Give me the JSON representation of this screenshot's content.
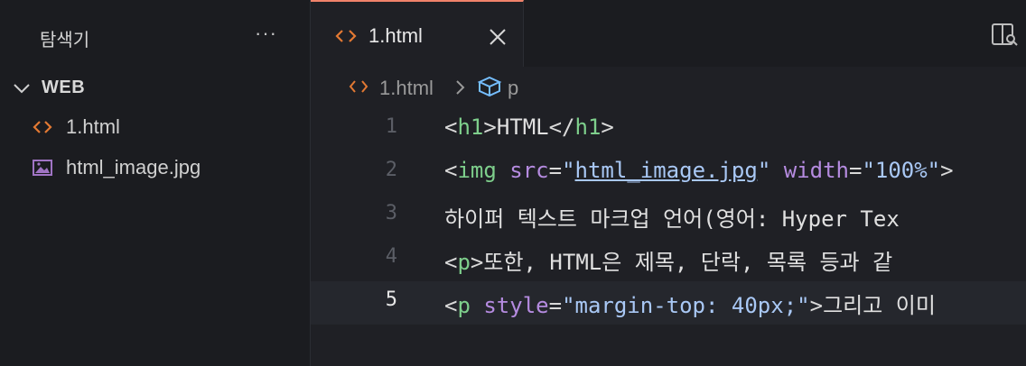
{
  "sidebar": {
    "title": "탐색기",
    "more": "···",
    "folder": "WEB",
    "files": [
      {
        "name": "1.html",
        "icon": "html-file-icon"
      },
      {
        "name": "html_image.jpg",
        "icon": "image-file-icon"
      }
    ]
  },
  "tab": {
    "label": "1.html"
  },
  "breadcrumb": {
    "file": "1.html",
    "element": "p"
  },
  "editor": {
    "current_line": 5,
    "lines": [
      {
        "n": "1"
      },
      {
        "n": "2"
      },
      {
        "n": "3"
      },
      {
        "n": "4"
      },
      {
        "n": "5"
      }
    ],
    "tokens": {
      "l1": {
        "open": "<",
        "tag": "h1",
        "close": ">",
        "text": "HTML",
        "open2": "</",
        "tag2": "h1",
        "close2": ">"
      },
      "l2": {
        "open": "<",
        "tag": "img",
        "sp1": " ",
        "attr1": "src",
        "eq1": "=",
        "val1q1": "\"",
        "val1": "html_image.jpg",
        "val1q2": "\"",
        "sp2": " ",
        "attr2": "width",
        "eq2": "=",
        "val2": "\"100%\"",
        "close": ">"
      },
      "l3": {
        "text": "하이퍼 텍스트 마크업 언어(영어: Hyper Tex"
      },
      "l4": {
        "open": "<",
        "tag": "p",
        "close": ">",
        "text": "또한, HTML은 제목, 단락, 목록 등과 같"
      },
      "l5": {
        "open": "<",
        "tag": "p",
        "sp1": " ",
        "attr1": "style",
        "eq1": "=",
        "val1": "\"margin-top: 40px;\"",
        "close": ">",
        "text": "그리고 이미"
      }
    }
  },
  "colors": {
    "tab_accent": "#f0826a",
    "tag": "#7ecf8c",
    "attribute": "#b58be0",
    "string": "#a9c8f5"
  }
}
